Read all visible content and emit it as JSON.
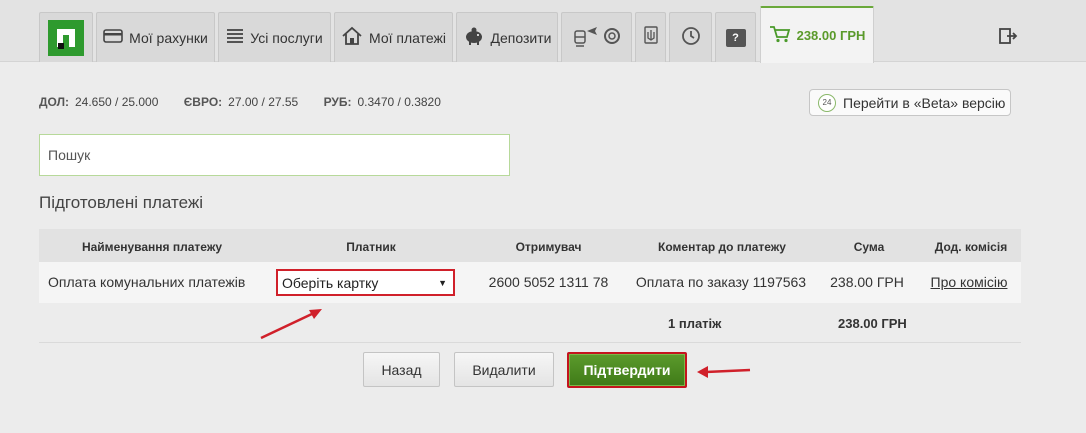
{
  "nav": {
    "accounts_label": "Мої рахунки",
    "services_label": "Усі послуги",
    "payments_label": "Мої платежі",
    "deposits_label": "Депозити",
    "help_label": "?",
    "cart_label": "238.00 ГРН"
  },
  "rates": {
    "usd_label": "ДОЛ:",
    "usd_value": "24.650 / 25.000",
    "eur_label": "ЄВРО:",
    "eur_value": "27.00 / 27.55",
    "rub_label": "РУБ:",
    "rub_value": "0.3470 / 0.3820"
  },
  "beta": {
    "badge": "24",
    "label": "Перейти в «Beta» версію"
  },
  "search": {
    "placeholder": "Пошук"
  },
  "section_title": "Підготовлені платежі",
  "table": {
    "headers": [
      "Найменування платежу",
      "Платник",
      "Отримувач",
      "Коментар до платежу",
      "Сума",
      "Дод. комісія"
    ],
    "rows": [
      {
        "name": "Оплата комунальних платежів",
        "payer_select": "Оберіть картку",
        "recipient": "2600 5052 1311 78",
        "comment": "Оплата по заказу 1197563",
        "amount": "238.00 ГРН",
        "commission_link": "Про комісію"
      }
    ],
    "footer": {
      "count": "1 платіж",
      "total": "238.00 ГРН"
    }
  },
  "buttons": {
    "back": "Назад",
    "delete": "Видалити",
    "confirm": "Підтвердити"
  },
  "colors": {
    "brand_green": "#2e9a2e",
    "confirm_green": "#4a8a22",
    "highlight_red": "#d0202a"
  }
}
